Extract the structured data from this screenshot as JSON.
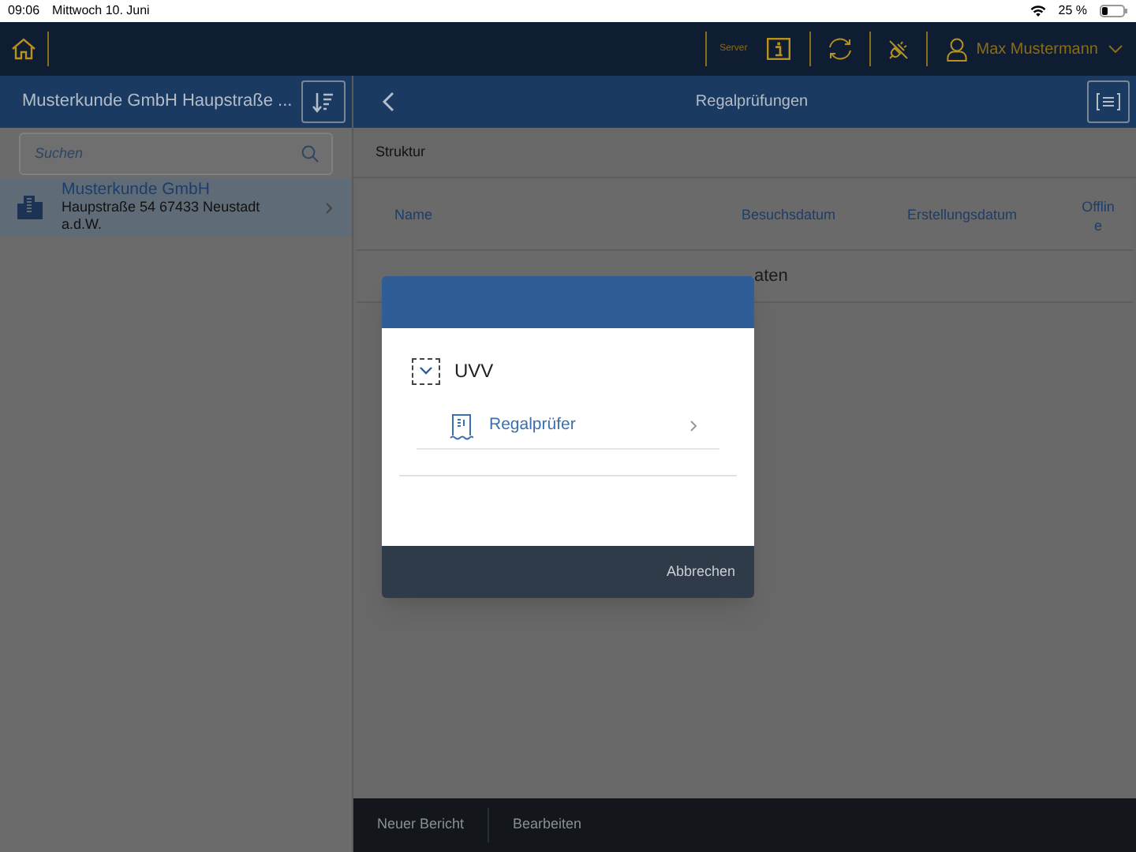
{
  "status_bar": {
    "time": "09:06",
    "date": "Mittwoch 10. Juni",
    "battery": "25 %"
  },
  "shell": {
    "server_label": "Server",
    "user": "Max Mustermann"
  },
  "master": {
    "title": "Musterkunde GmbH Haupstraße ...",
    "search": {
      "placeholder": "Suchen"
    },
    "items": [
      {
        "title": "Musterkunde GmbH",
        "subtitle": "Haupstraße 54 67433 Neustadt a.d.W.",
        "selected": true
      }
    ]
  },
  "detail": {
    "title": "Regalprüfungen",
    "section": "Struktur",
    "columns": [
      "Name",
      "Besuchsdatum",
      "Erstellungsdatum",
      "Offlin e"
    ],
    "empty_text": "aten"
  },
  "dialog": {
    "tree": [
      {
        "label": "UVV",
        "expanded": true,
        "children": [
          {
            "label": "Regalprüfer"
          }
        ]
      }
    ],
    "buttons": [
      "Abbrechen"
    ]
  },
  "footer": {
    "buttons": [
      "Neuer Bericht",
      "Bearbeiten"
    ]
  }
}
